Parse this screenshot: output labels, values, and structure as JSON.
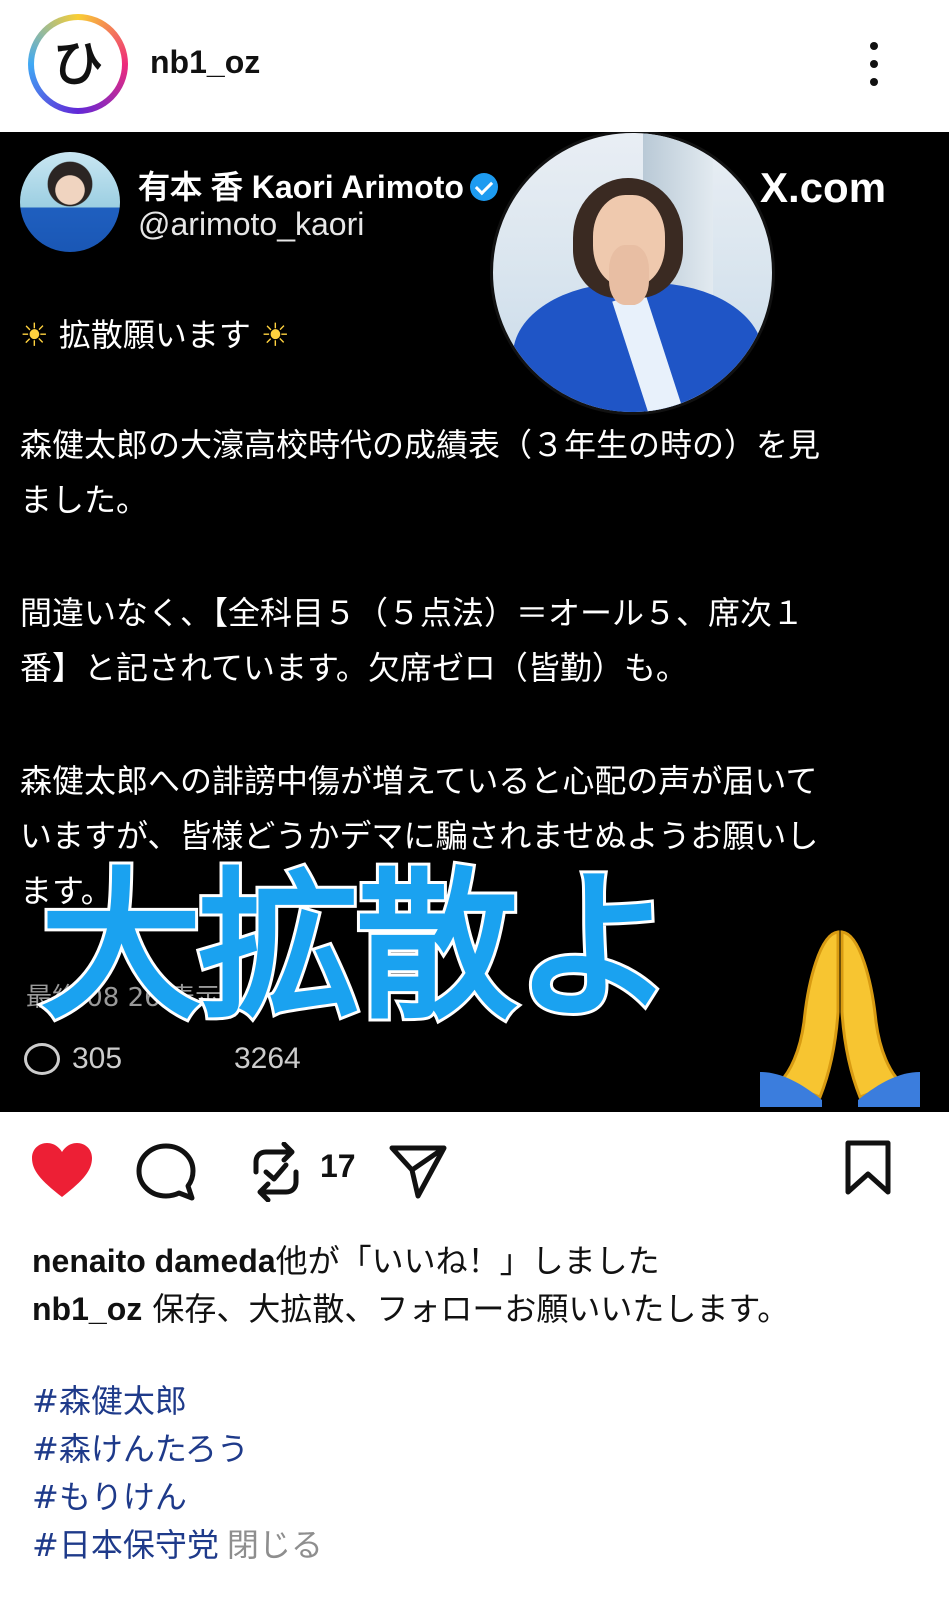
{
  "header": {
    "avatar_glyph": "ひ",
    "username": "nb1_oz"
  },
  "tweet": {
    "name": "有本 香 Kaori Arimoto",
    "handle": "@arimoto_kaori",
    "brand": "X.com",
    "line1_sun_left": "☀",
    "line1_text": "拡散願います",
    "line1_sun_right": "☀",
    "para1_line1": "森健太郎の大濠高校時代の成績表（３年生の時の）を見",
    "para1_line2": "ました。",
    "para2_line1": "間違いなく、【全科目５（５点法）＝オール５、席次１",
    "para2_line2": "番】と記されています。欠席ゼロ（皆勤）も。",
    "para3_line1": "森健太郎への誹謗中傷が増えていると心配の声が届いて",
    "para3_line2": "いますが、皆様どうかデマに騙されませぬようお願いし",
    "para3_line3": "ます。",
    "meta_partial": "最終  08  26  表示",
    "reply_count": "305",
    "retweet_count_partial": "3264",
    "colors": {
      "overlay_text": "#1aa2f0",
      "verified": "#1d9bf0"
    }
  },
  "overlay_text": "大拡散よ",
  "overlay_emoji": "praying-hands",
  "actions": {
    "repost_count": "17",
    "like_color": "#ed1f35"
  },
  "likes_line": {
    "users": "nenaito  dameda",
    "suffix": "他が「いいね！」しました"
  },
  "caption": {
    "username": "nb1_oz",
    "text": "保存、大拡散、フォローお願いいたします。"
  },
  "hashtags": [
    "#森健太郎",
    "#森けんたろう",
    "#もりけん",
    "#日本保守党"
  ],
  "close_label": "閉じる"
}
